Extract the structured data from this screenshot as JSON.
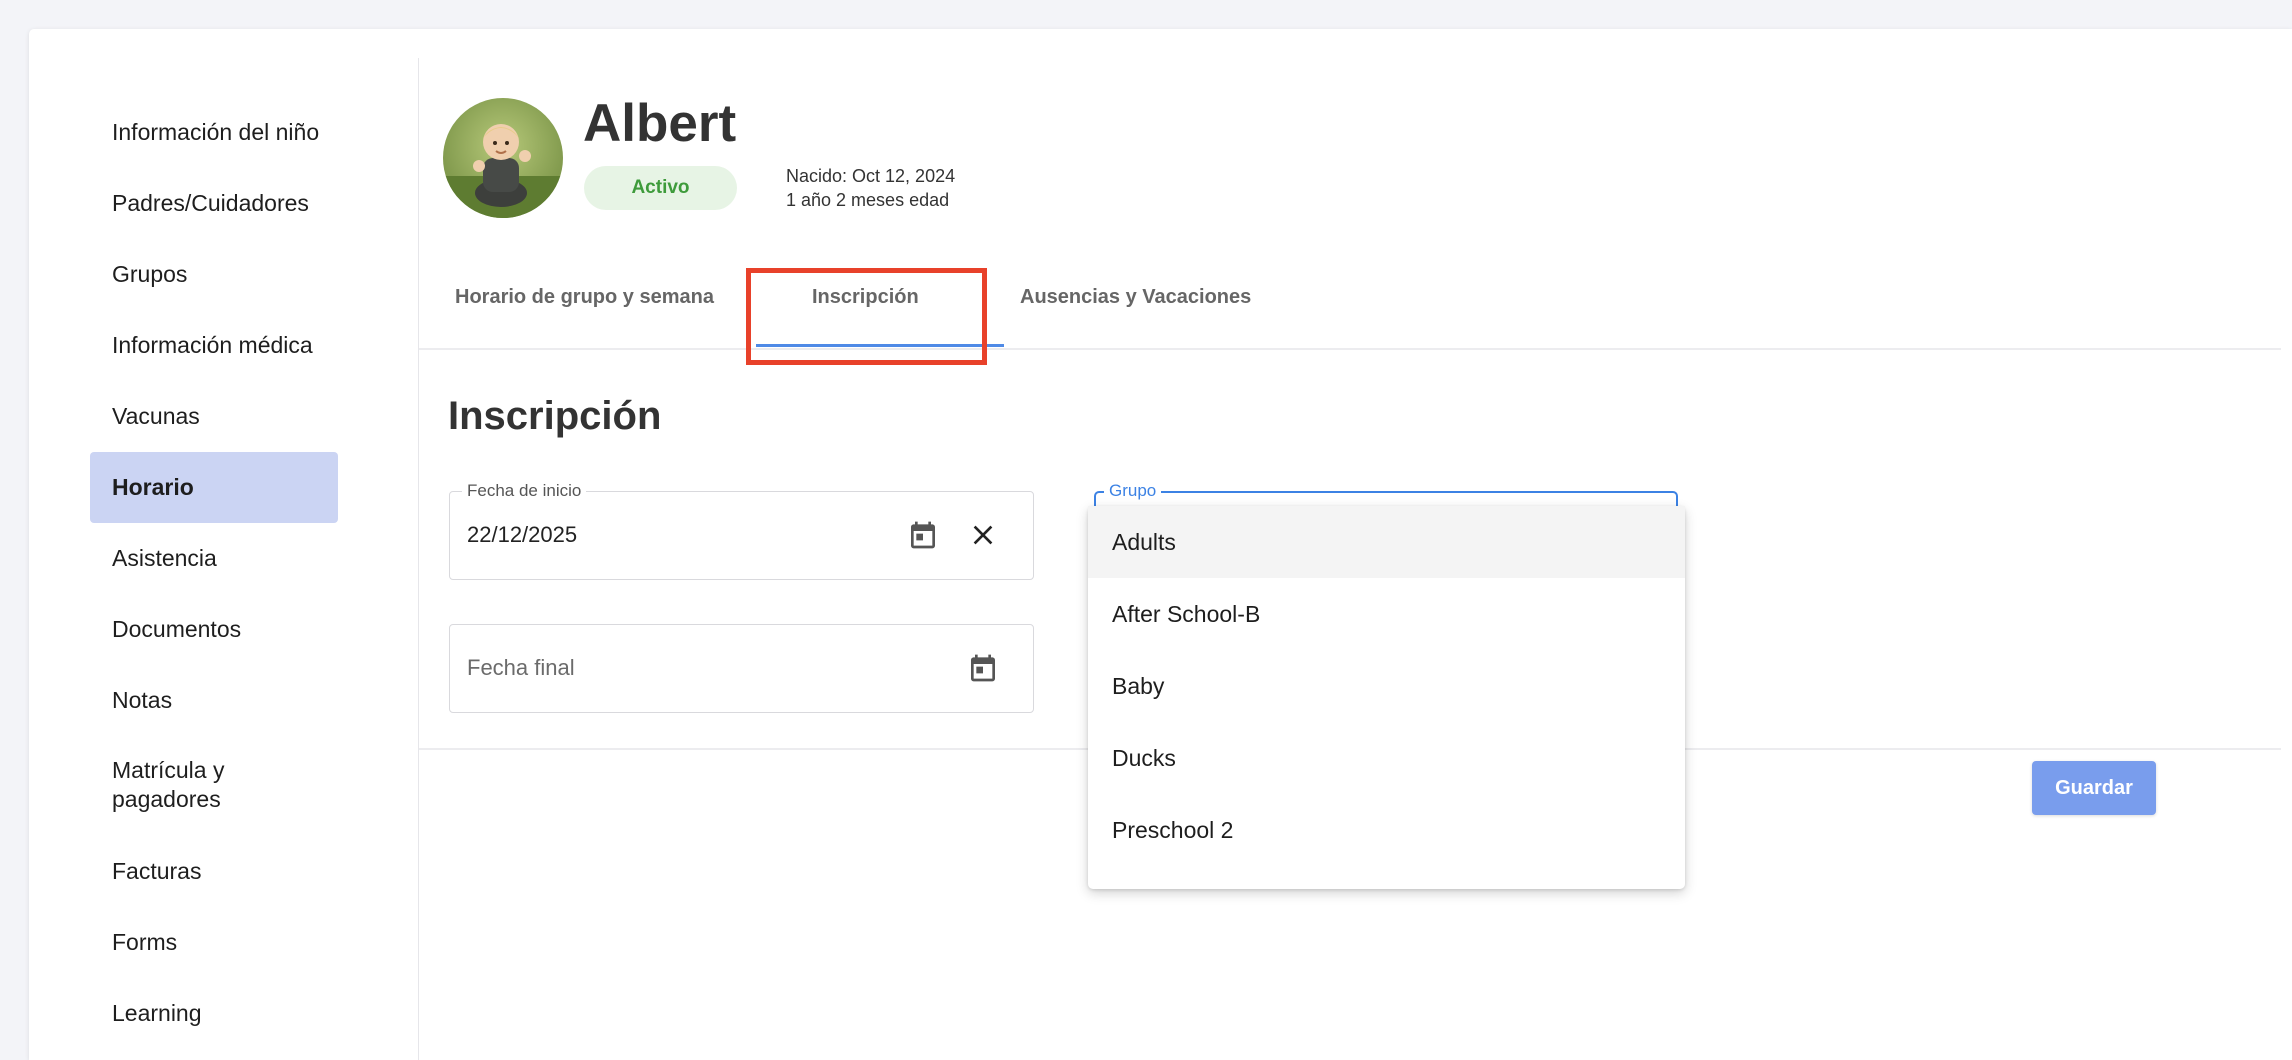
{
  "sidebar": {
    "items": [
      {
        "label": "Información del niño"
      },
      {
        "label": "Padres/Cuidadores"
      },
      {
        "label": "Grupos"
      },
      {
        "label": "Información médica"
      },
      {
        "label": "Vacunas"
      },
      {
        "label": "Horario",
        "active": true
      },
      {
        "label": "Asistencia"
      },
      {
        "label": "Documentos"
      },
      {
        "label": "Notas"
      },
      {
        "label": "Matrícula y\npagadores"
      },
      {
        "label": "Facturas"
      },
      {
        "label": "Forms"
      },
      {
        "label": "Learning"
      }
    ]
  },
  "child": {
    "name": "Albert",
    "status": "Activo",
    "born": "Nacido: Oct 12, 2024",
    "age": "1 año 2 meses edad"
  },
  "tabs": [
    {
      "label": "Horario de grupo y semana"
    },
    {
      "label": "Inscripción",
      "active": true
    },
    {
      "label": "Ausencias y Vacaciones"
    }
  ],
  "section": {
    "title": "Inscripción",
    "start_date": {
      "label": "Fecha de inicio",
      "value": "22/12/2025"
    },
    "end_date": {
      "placeholder": "Fecha final"
    },
    "group": {
      "label": "Grupo",
      "options": [
        "Adults",
        "After School-B",
        "Baby",
        "Ducks",
        "Preschool 2"
      ],
      "hovered_option": "Adults"
    },
    "save_label": "Guardar"
  },
  "colors": {
    "accent": "#3c82e4",
    "active_nav_bg": "#cbd4f3",
    "status_bg": "#e7f4e5",
    "status_text": "#3e9b3b",
    "save_button": "#799ded",
    "highlight_border": "#e8412a"
  },
  "icons": {
    "start_date_calendar": "calendar-icon",
    "start_date_clear": "close-icon",
    "end_date_calendar": "calendar-icon"
  }
}
